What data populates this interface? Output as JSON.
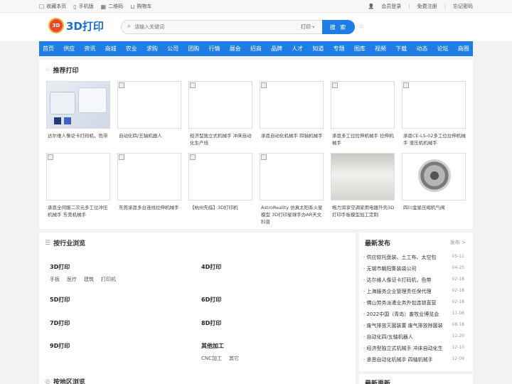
{
  "topbar": {
    "left": [
      {
        "icon": "bookmark-icon",
        "glyph": "☐",
        "label": "收藏本页"
      },
      {
        "icon": "mobile-icon",
        "glyph": "▯",
        "label": "手机版"
      },
      {
        "icon": "qrcode-icon",
        "glyph": "▦",
        "label": "二维码"
      },
      {
        "icon": "cart-icon",
        "glyph": "⊔",
        "label": "购物车"
      }
    ],
    "right": [
      {
        "label": "会员登录"
      },
      {
        "label": "免费注册"
      },
      {
        "label": "忘记密码"
      }
    ]
  },
  "header": {
    "logo_badge": "3D",
    "logo_text": "3D打印",
    "search_placeholder": "请输入关键词",
    "search_category": "打印",
    "search_button": "搜 索"
  },
  "nav": [
    "首页",
    "供应",
    "资讯",
    "商城",
    "农业",
    "求购",
    "公司",
    "团购",
    "行情",
    "展会",
    "招商",
    "品牌",
    "人才",
    "知道",
    "专题",
    "图库",
    "视频",
    "下载",
    "动态",
    "论坛",
    "商圈"
  ],
  "recommend": {
    "title": "推荐打印",
    "items": [
      {
        "caption": "达尔维人像证卡打码机，色带",
        "image": "photo"
      },
      {
        "caption": "自动化四/五轴机器人",
        "image": "broken"
      },
      {
        "caption": "经济型独立式机械手 冲床自动化生产线",
        "image": "broken"
      },
      {
        "caption": "承恩自动化机械手 四轴机械手",
        "image": "broken"
      },
      {
        "caption": "承恩多工位拉伸机械手 拉伸机械手",
        "image": "broken"
      },
      {
        "caption": "承恩CE-LS-02多工位拉伸机械手 液压机机械手",
        "image": "broken"
      },
      {
        "caption": "承恩全伺服二次元多工位冲压机械手 东莞机械手",
        "image": "broken"
      },
      {
        "caption": "东莞承恩多台连线拉伸机械手",
        "image": "broken"
      },
      {
        "caption": "【杭州先临】3D打印机",
        "image": "broken"
      },
      {
        "caption": "AstroReality 仿真太阳系火星模型 3D打印星球手办AR天文科普",
        "image": "broken"
      },
      {
        "caption": "格力润享空调家用电器外壳3D打印手板模型加工定制",
        "image": "photo-white"
      },
      {
        "caption": "四川金星压缩机气阀",
        "image": "photo-valve"
      }
    ]
  },
  "industry": {
    "title": "按行业浏览",
    "groups": [
      {
        "title": "3D打印",
        "links": [
          "手板",
          "医疗",
          "建筑",
          "打印机"
        ]
      },
      {
        "title": "4D打印",
        "links": []
      },
      {
        "title": "5D打印",
        "links": []
      },
      {
        "title": "6D打印",
        "links": []
      },
      {
        "title": "7D打印",
        "links": []
      },
      {
        "title": "8D打印",
        "links": []
      },
      {
        "title": "9D打印",
        "links": []
      },
      {
        "title": "其他加工",
        "links": [
          "CNC加工",
          "其它"
        ]
      }
    ]
  },
  "region": {
    "title": "按地区浏览"
  },
  "latest": {
    "title": "最新发布",
    "more": "发布 >",
    "items": [
      {
        "title": "· 供应软托盘装、土工布、太空包",
        "date": "05-11"
      },
      {
        "title": "· 无锡市朝阳集装袋公司",
        "date": "04-25"
      },
      {
        "title": "· 达尔维人像证卡打码机，色带",
        "date": "02-18"
      },
      {
        "title": "· 上海服务企业管理责任保代理",
        "date": "02-18"
      },
      {
        "title": "· 佛山劳务派遣业务外包连锁直营",
        "date": "02-18"
      },
      {
        "title": "· 2022中国（青岛）畜牧业博览会",
        "date": "11-08"
      },
      {
        "title": "· 废气排放灭菌装置 废气排放除菌装",
        "date": "08-18"
      },
      {
        "title": "· 自动化四/五轴机器人",
        "date": "12-20"
      },
      {
        "title": "· 经济型独立式机械手 冲床自动化生",
        "date": "12-10"
      },
      {
        "title": "· 承恩自动化机械手 四轴机械手",
        "date": "12-09"
      }
    ]
  },
  "latest_update": {
    "title": "最新更新"
  }
}
